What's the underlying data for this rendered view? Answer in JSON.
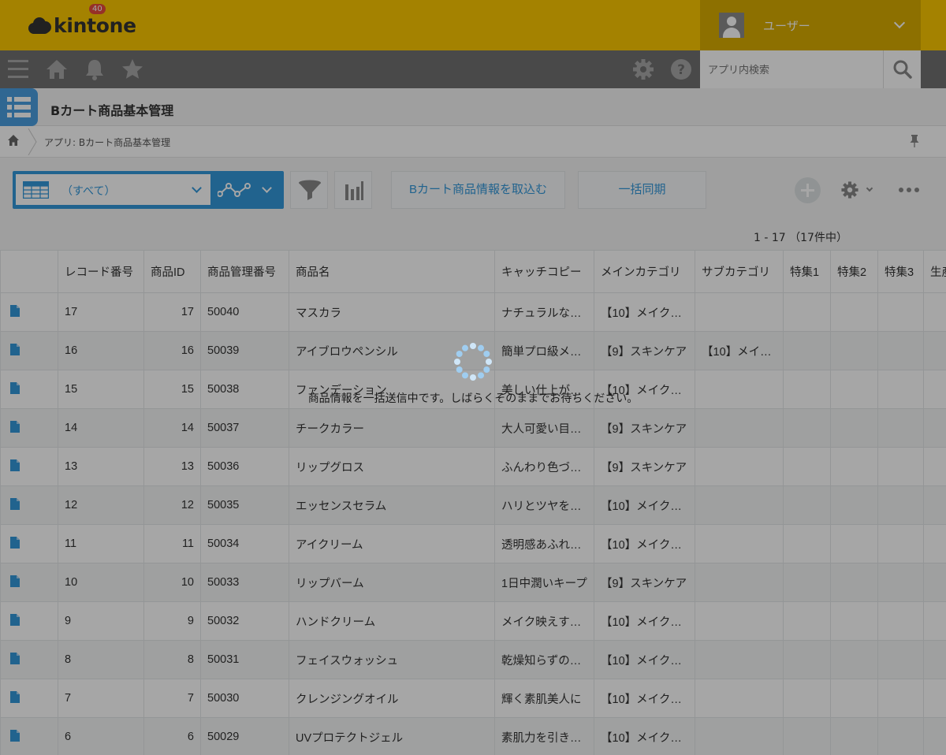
{
  "header": {
    "logo_text": "kintone",
    "user_name": "ユーザー",
    "colors": {
      "topbar": "#fcc800",
      "navbar": "#707070",
      "accent": "#3498db"
    }
  },
  "nav": {
    "notification_count": "40",
    "search_placeholder": "アプリ内検索",
    "icons": [
      "menu-icon",
      "home-icon",
      "bell-icon",
      "star-icon",
      "gear-icon",
      "help-icon",
      "search-icon"
    ]
  },
  "app": {
    "title": "Bカート商品基本管理",
    "breadcrumb": "アプリ: Bカート商品基本管理"
  },
  "toolbar": {
    "view_name": "（すべて）",
    "import_button": "Bカート商品情報を取込む",
    "sync_button": "一括同期"
  },
  "list": {
    "count_text": "1 - 17 （17件中）",
    "columns": [
      "",
      "レコード番号",
      "商品ID",
      "商品管理番号",
      "商品名",
      "キャッチコピー",
      "メインカテゴリ",
      "サブカテゴリ",
      "特集1",
      "特集2",
      "特集3",
      "生産"
    ],
    "rows": [
      [
        "17",
        "17",
        "50040",
        "マスカラ",
        "ナチュラルな美…",
        "【10】メイク…",
        "",
        "",
        "",
        ""
      ],
      [
        "16",
        "16",
        "50039",
        "アイブロウペンシル",
        "簡単プロ級メイク",
        "【9】スキンケア",
        "【10】メイ…",
        "",
        "",
        ""
      ],
      [
        "15",
        "15",
        "50038",
        "ファンデーション",
        "美しい仕上がり…",
        "【10】メイク…",
        "",
        "",
        "",
        ""
      ],
      [
        "14",
        "14",
        "50037",
        "チークカラー",
        "大人可愛い目元に",
        "【9】スキンケア",
        "",
        "",
        "",
        ""
      ],
      [
        "13",
        "13",
        "50036",
        "リップグロス",
        "ふんわり色づく唇",
        "【9】スキンケア",
        "",
        "",
        "",
        ""
      ],
      [
        "12",
        "12",
        "50035",
        "エッセンスセラム",
        "ハリとツヤをプ…",
        "【10】メイク…",
        "",
        "",
        "",
        ""
      ],
      [
        "11",
        "11",
        "50034",
        "アイクリーム",
        "透明感あふれる…",
        "【10】メイク…",
        "",
        "",
        "",
        ""
      ],
      [
        "10",
        "10",
        "50033",
        "リップバーム",
        "1日中潤いキープ",
        "【9】スキンケア",
        "",
        "",
        "",
        ""
      ],
      [
        "9",
        "9",
        "50032",
        "ハンドクリーム",
        "メイク映えする…",
        "【10】メイク…",
        "",
        "",
        "",
        ""
      ],
      [
        "8",
        "8",
        "50031",
        "フェイスウォッシュ",
        "乾燥知らずのし…",
        "【10】メイク…",
        "",
        "",
        "",
        ""
      ],
      [
        "7",
        "7",
        "50030",
        "クレンジングオイル",
        "輝く素肌美人に",
        "【10】メイク…",
        "",
        "",
        "",
        ""
      ],
      [
        "6",
        "6",
        "50029",
        "UVプロテクトジェル",
        "素肌力を引き出す",
        "【10】メイク…",
        "",
        "",
        "",
        ""
      ]
    ]
  },
  "overlay": {
    "message": "商品情報を一括送信中です。しばらくそのままでお待ちください。"
  }
}
